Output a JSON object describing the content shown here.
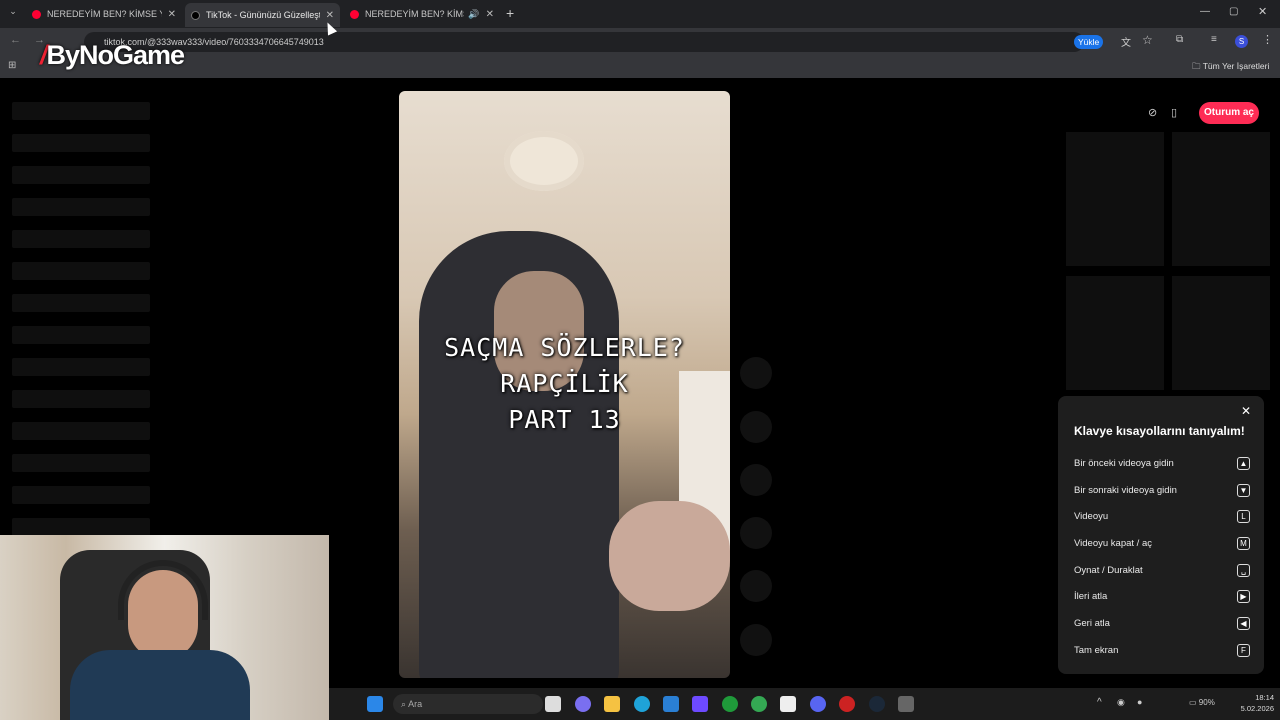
{
  "tabs": [
    {
      "title": "NEREDEYİM BEN? KİMSE YOK N",
      "favicon_color": "#ff0033"
    },
    {
      "title": "TikTok - Gününüzü Güzelleştirin",
      "favicon_color": "#111111"
    },
    {
      "title": "NEREDEYİM BEN? KİMSE YO",
      "favicon_color": "#ff0033"
    }
  ],
  "address": {
    "url": "tiktok.com/@333wav333/video/7603334706645749013"
  },
  "toolbar": {
    "install_label": "Yükle"
  },
  "bookmarks": {
    "all_bookmarks": "Tüm Yer İşaretleri"
  },
  "logo": {
    "text": "ByNoGame"
  },
  "video": {
    "caption_lines": [
      "SAÇMA SÖZLERLE?",
      "RAPÇİLİK",
      "PART 13"
    ]
  },
  "header": {
    "login_label": "Oturum aç"
  },
  "shortcuts": {
    "title": "Klavye kısayollarını tanıyalım!",
    "items": [
      {
        "label": "Bir önceki videoya gidin",
        "key": "▲"
      },
      {
        "label": "Bir sonraki videoya gidin",
        "key": "▼"
      },
      {
        "label": "Videoyu",
        "key": "L"
      },
      {
        "label": "Videoyu kapat / aç",
        "key": "M"
      },
      {
        "label": "Oynat / Duraklat",
        "key": "␣"
      },
      {
        "label": "İleri atla",
        "key": "▶"
      },
      {
        "label": "Geri atla",
        "key": "◀"
      },
      {
        "label": "Tam ekran",
        "key": "F"
      }
    ]
  },
  "taskbar": {
    "search_placeholder": "Ara",
    "battery": "90%",
    "time": "18:14",
    "date": "5.02.2026"
  },
  "colors": {
    "accent": "#fe2c55",
    "chrome_dark": "#202124",
    "chrome": "#35363a"
  }
}
